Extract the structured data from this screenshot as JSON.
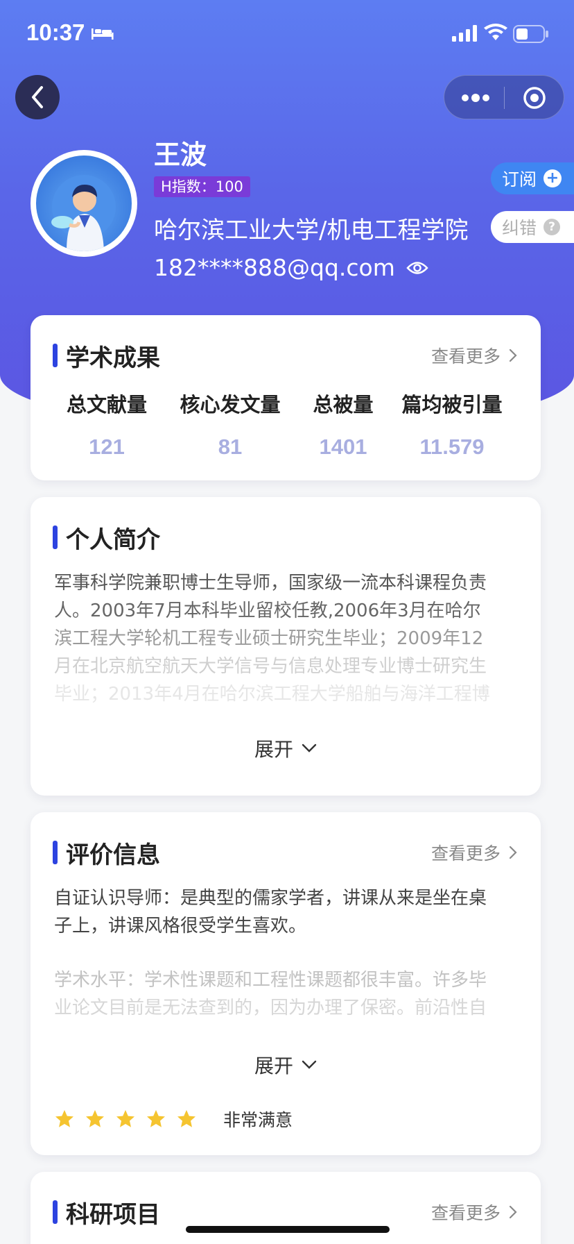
{
  "status_bar": {
    "time": "10:37"
  },
  "profile": {
    "name": "王波",
    "h_index": "H指数：100",
    "affiliation": "哈尔滨工业大学/机电工程学院",
    "email": "182****888@qq.com",
    "subscribe_label": "订阅",
    "correct_label": "纠错"
  },
  "academic": {
    "title": "学术成果",
    "see_more": "查看更多",
    "stats": [
      {
        "label": "总文献量",
        "value": "121"
      },
      {
        "label": "核心发文量",
        "value": "81"
      },
      {
        "label": "总被量",
        "value": "1401"
      },
      {
        "label": "篇均被引量",
        "value": "11.579"
      }
    ]
  },
  "bio": {
    "title": "个人简介",
    "lines": [
      "军事科学院兼职博士生导师，国家级一流本科课程负责",
      "人。2003年7月本科毕业留校任教,2006年3月在哈尔",
      "滨工程大学轮机工程专业硕士研究生毕业；2009年12",
      "月在北京航空航天大学信号与信息处理专业博士研究生",
      "毕业；2013年4月在哈尔滨工程大学船舶与海洋工程博"
    ],
    "expand_label": "展开"
  },
  "evaluation": {
    "title": "评价信息",
    "see_more": "查看更多",
    "lines": [
      "自证认识导师：是典型的儒家学者，讲课从来是坐在桌",
      "子上，讲课风格很受学生喜欢。"
    ],
    "faded_lines": [
      "学术水平：学术性课题和工程性课题都很丰富。许多毕",
      "业论文目前是无法查到的，因为办理了保密。前沿性自"
    ],
    "expand_label": "展开",
    "rating": 5,
    "rating_text": "非常满意"
  },
  "projects": {
    "title": "科研项目",
    "see_more": "查看更多"
  },
  "colors": {
    "accent_bar": "#2d43e0",
    "hero_top": "#5d7df2",
    "hero_bottom": "#5b55e2",
    "stat_value": "#a8aee0",
    "star": "#f5c430"
  }
}
